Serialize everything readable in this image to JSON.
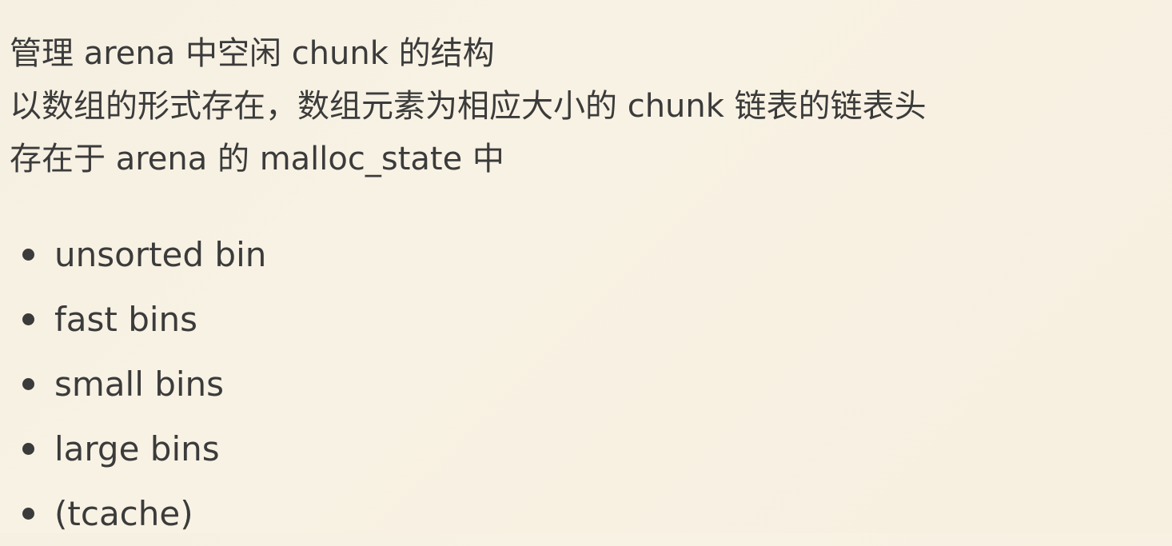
{
  "intro": [
    "管理 arena 中空闲 chunk 的结构",
    "以数组的形式存在，数组元素为相应大小的 chunk 链表的链表头",
    "存在于 arena 的 malloc_state 中"
  ],
  "bins": [
    "unsorted bin",
    "fast bins",
    "small bins",
    "large bins",
    "(tcache)"
  ]
}
